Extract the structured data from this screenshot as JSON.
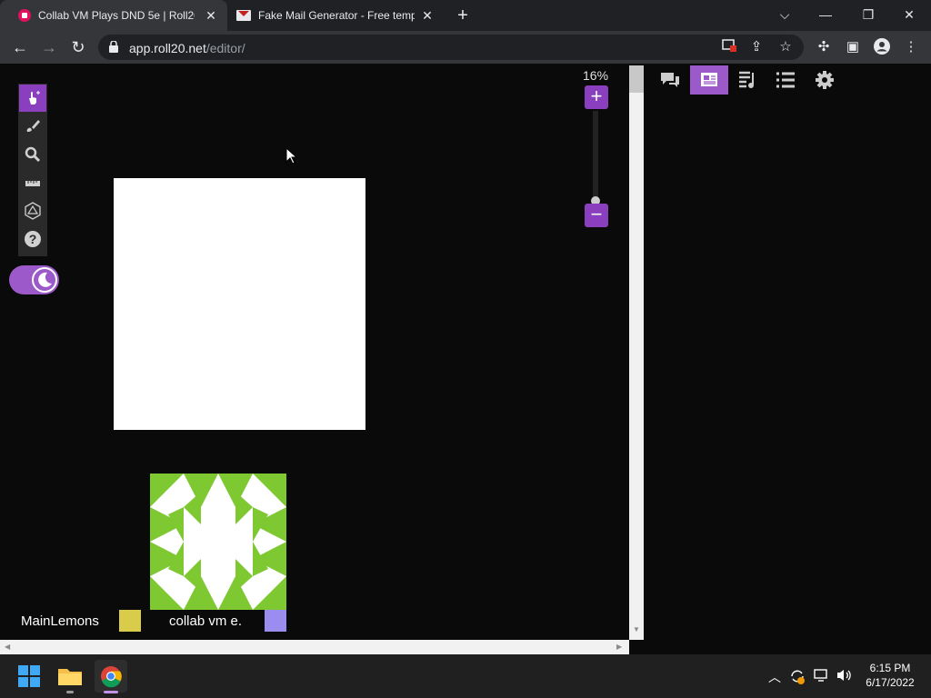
{
  "browser": {
    "tabs": [
      {
        "title": "Collab VM Plays DND 5e | Roll20",
        "active": true,
        "favicon": "roll20-icon"
      },
      {
        "title": "Fake Mail Generator - Free temp",
        "active": false,
        "favicon": "mail-icon"
      }
    ],
    "address": {
      "domain": "app.roll20.net",
      "path": "/editor/"
    }
  },
  "roll20": {
    "zoom_label": "16%",
    "zoom_in": "+",
    "zoom_out": "−",
    "players": [
      {
        "name": "MainLemons",
        "color": "#d8cc4a"
      },
      {
        "name": "collab vm e.",
        "color": "#9b8cf0"
      }
    ],
    "accent": "#8a3fbf"
  },
  "taskbar": {
    "time": "6:15 PM",
    "date": "6/17/2022"
  }
}
